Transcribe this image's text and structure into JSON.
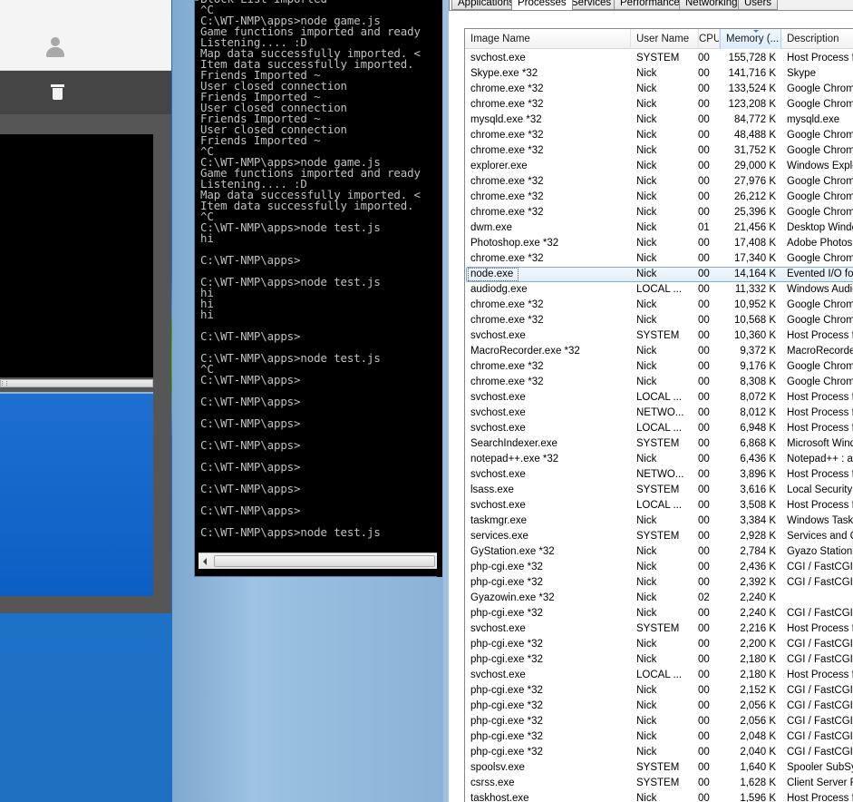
{
  "cmd": {
    "lines": [
      "Block List Imported ~",
      "^C",
      "C:\\WT-NMP\\apps>node game.js",
      "Game functions imported and ready",
      "Listening.... :D",
      "Map data successfully imported. <",
      "Item data successfully imported.",
      "Friends Imported ~",
      "User closed connection",
      "Friends Imported ~",
      "User closed connection",
      "Friends Imported ~",
      "User closed connection",
      "Friends Imported ~",
      "^C",
      "C:\\WT-NMP\\apps>node game.js",
      "Game functions imported and ready",
      "Listening.... :D",
      "Map data successfully imported. <",
      "Item data successfully imported.",
      "^C",
      "C:\\WT-NMP\\apps>node test.js",
      "hi",
      "",
      "C:\\WT-NMP\\apps>",
      "",
      "C:\\WT-NMP\\apps>node test.js",
      "hi",
      "hi",
      "hi",
      "",
      "C:\\WT-NMP\\apps>",
      "",
      "C:\\WT-NMP\\apps>node test.js",
      "^C",
      "C:\\WT-NMP\\apps>",
      "",
      "C:\\WT-NMP\\apps>",
      "",
      "C:\\WT-NMP\\apps>",
      "",
      "C:\\WT-NMP\\apps>",
      "",
      "C:\\WT-NMP\\apps>",
      "",
      "C:\\WT-NMP\\apps>",
      "",
      "C:\\WT-NMP\\apps>",
      "",
      "C:\\WT-NMP\\apps>node test.js"
    ]
  },
  "task_manager": {
    "tabs": [
      "Applications",
      "Processes",
      "Services",
      "Performance",
      "Networking",
      "Users"
    ],
    "active_tab": "Processes",
    "columns": {
      "image_name": "Image Name",
      "user_name": "User Name",
      "cpu": "CPU",
      "memory": "Memory (...",
      "description": "Description"
    },
    "selected_row": 14,
    "rows": [
      {
        "name": "svchost.exe",
        "user": "SYSTEM",
        "cpu": "00",
        "mem": "155,728 K",
        "desc": "Host Process fo"
      },
      {
        "name": "Skype.exe *32",
        "user": "Nick",
        "cpu": "00",
        "mem": "141,716 K",
        "desc": "Skype"
      },
      {
        "name": "chrome.exe *32",
        "user": "Nick",
        "cpu": "00",
        "mem": "133,524 K",
        "desc": "Google Chrome"
      },
      {
        "name": "chrome.exe *32",
        "user": "Nick",
        "cpu": "00",
        "mem": "123,208 K",
        "desc": "Google Chrome"
      },
      {
        "name": "mysqld.exe *32",
        "user": "Nick",
        "cpu": "00",
        "mem": "84,772 K",
        "desc": "mysqld.exe"
      },
      {
        "name": "chrome.exe *32",
        "user": "Nick",
        "cpu": "00",
        "mem": "48,488 K",
        "desc": "Google Chrome"
      },
      {
        "name": "chrome.exe *32",
        "user": "Nick",
        "cpu": "00",
        "mem": "31,752 K",
        "desc": "Google Chrome"
      },
      {
        "name": "explorer.exe",
        "user": "Nick",
        "cpu": "00",
        "mem": "29,000 K",
        "desc": "Windows Explo"
      },
      {
        "name": "chrome.exe *32",
        "user": "Nick",
        "cpu": "00",
        "mem": "27,976 K",
        "desc": "Google Chrome"
      },
      {
        "name": "chrome.exe *32",
        "user": "Nick",
        "cpu": "00",
        "mem": "26,212 K",
        "desc": "Google Chrome"
      },
      {
        "name": "chrome.exe *32",
        "user": "Nick",
        "cpu": "00",
        "mem": "25,396 K",
        "desc": "Google Chrome"
      },
      {
        "name": "dwm.exe",
        "user": "Nick",
        "cpu": "01",
        "mem": "21,456 K",
        "desc": "Desktop Windo"
      },
      {
        "name": "Photoshop.exe *32",
        "user": "Nick",
        "cpu": "00",
        "mem": "17,408 K",
        "desc": "Adobe Photosh"
      },
      {
        "name": "chrome.exe *32",
        "user": "Nick",
        "cpu": "00",
        "mem": "17,340 K",
        "desc": "Google Chrome"
      },
      {
        "name": "node.exe",
        "user": "Nick",
        "cpu": "00",
        "mem": "14,164 K",
        "desc": "Evented I/O fo"
      },
      {
        "name": "audiodg.exe",
        "user": "LOCAL ...",
        "cpu": "00",
        "mem": "11,332 K",
        "desc": "Windows Audio"
      },
      {
        "name": "chrome.exe *32",
        "user": "Nick",
        "cpu": "00",
        "mem": "10,952 K",
        "desc": "Google Chrome"
      },
      {
        "name": "chrome.exe *32",
        "user": "Nick",
        "cpu": "00",
        "mem": "10,568 K",
        "desc": "Google Chrome"
      },
      {
        "name": "svchost.exe",
        "user": "SYSTEM",
        "cpu": "00",
        "mem": "10,360 K",
        "desc": "Host Process fo"
      },
      {
        "name": "MacroRecorder.exe *32",
        "user": "Nick",
        "cpu": "00",
        "mem": "9,372 K",
        "desc": "MacroRecorder"
      },
      {
        "name": "chrome.exe *32",
        "user": "Nick",
        "cpu": "00",
        "mem": "9,176 K",
        "desc": "Google Chrome"
      },
      {
        "name": "chrome.exe *32",
        "user": "Nick",
        "cpu": "00",
        "mem": "8,308 K",
        "desc": "Google Chrome"
      },
      {
        "name": "svchost.exe",
        "user": "LOCAL ...",
        "cpu": "00",
        "mem": "8,072 K",
        "desc": "Host Process fo"
      },
      {
        "name": "svchost.exe",
        "user": "NETWO...",
        "cpu": "00",
        "mem": "8,012 K",
        "desc": "Host Process fo"
      },
      {
        "name": "svchost.exe",
        "user": "LOCAL ...",
        "cpu": "00",
        "mem": "6,948 K",
        "desc": "Host Process fo"
      },
      {
        "name": "SearchIndexer.exe",
        "user": "SYSTEM",
        "cpu": "00",
        "mem": "6,868 K",
        "desc": "Microsoft Windo"
      },
      {
        "name": "notepad++.exe *32",
        "user": "Nick",
        "cpu": "00",
        "mem": "6,436 K",
        "desc": "Notepad++ : a"
      },
      {
        "name": "svchost.exe",
        "user": "NETWO...",
        "cpu": "00",
        "mem": "3,896 K",
        "desc": "Host Process fo"
      },
      {
        "name": "lsass.exe",
        "user": "SYSTEM",
        "cpu": "00",
        "mem": "3,616 K",
        "desc": "Local Security A"
      },
      {
        "name": "svchost.exe",
        "user": "LOCAL ...",
        "cpu": "00",
        "mem": "3,508 K",
        "desc": "Host Process fo"
      },
      {
        "name": "taskmgr.exe",
        "user": "Nick",
        "cpu": "00",
        "mem": "3,384 K",
        "desc": "Windows Task I"
      },
      {
        "name": "services.exe",
        "user": "SYSTEM",
        "cpu": "00",
        "mem": "2,928 K",
        "desc": "Services and Co"
      },
      {
        "name": "GyStation.exe *32",
        "user": "Nick",
        "cpu": "00",
        "mem": "2,784 K",
        "desc": "Gyazo Station"
      },
      {
        "name": "php-cgi.exe *32",
        "user": "Nick",
        "cpu": "00",
        "mem": "2,436 K",
        "desc": "CGI / FastCGI"
      },
      {
        "name": "php-cgi.exe *32",
        "user": "Nick",
        "cpu": "00",
        "mem": "2,392 K",
        "desc": "CGI / FastCGI"
      },
      {
        "name": "Gyazowin.exe *32",
        "user": "Nick",
        "cpu": "02",
        "mem": "2,240 K",
        "desc": ""
      },
      {
        "name": "php-cgi.exe *32",
        "user": "Nick",
        "cpu": "00",
        "mem": "2,240 K",
        "desc": "CGI / FastCGI"
      },
      {
        "name": "svchost.exe",
        "user": "SYSTEM",
        "cpu": "00",
        "mem": "2,216 K",
        "desc": "Host Process fo"
      },
      {
        "name": "php-cgi.exe *32",
        "user": "Nick",
        "cpu": "00",
        "mem": "2,200 K",
        "desc": "CGI / FastCGI"
      },
      {
        "name": "php-cgi.exe *32",
        "user": "Nick",
        "cpu": "00",
        "mem": "2,180 K",
        "desc": "CGI / FastCGI"
      },
      {
        "name": "svchost.exe",
        "user": "LOCAL ...",
        "cpu": "00",
        "mem": "2,180 K",
        "desc": "Host Process fo"
      },
      {
        "name": "php-cgi.exe *32",
        "user": "Nick",
        "cpu": "00",
        "mem": "2,152 K",
        "desc": "CGI / FastCGI"
      },
      {
        "name": "php-cgi.exe *32",
        "user": "Nick",
        "cpu": "00",
        "mem": "2,056 K",
        "desc": "CGI / FastCGI"
      },
      {
        "name": "php-cgi.exe *32",
        "user": "Nick",
        "cpu": "00",
        "mem": "2,056 K",
        "desc": "CGI / FastCGI"
      },
      {
        "name": "php-cgi.exe *32",
        "user": "Nick",
        "cpu": "00",
        "mem": "2,048 K",
        "desc": "CGI / FastCGI"
      },
      {
        "name": "php-cgi.exe *32",
        "user": "Nick",
        "cpu": "00",
        "mem": "2,040 K",
        "desc": "CGI / FastCGI"
      },
      {
        "name": "spoolsv.exe",
        "user": "SYSTEM",
        "cpu": "00",
        "mem": "1,640 K",
        "desc": "Spooler SubSys"
      },
      {
        "name": "csrss.exe",
        "user": "SYSTEM",
        "cpu": "00",
        "mem": "1,628 K",
        "desc": "Client Server R"
      },
      {
        "name": "taskhost.exe",
        "user": "Nick",
        "cpu": "00",
        "mem": "1,596 K",
        "desc": "Host Process fo"
      }
    ]
  }
}
